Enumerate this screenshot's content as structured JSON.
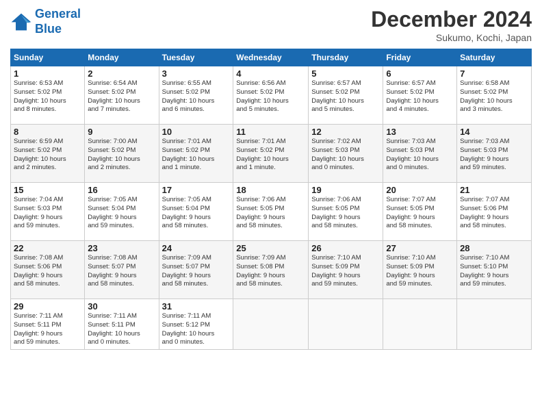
{
  "header": {
    "logo_line1": "General",
    "logo_line2": "Blue",
    "month": "December 2024",
    "location": "Sukumo, Kochi, Japan"
  },
  "weekdays": [
    "Sunday",
    "Monday",
    "Tuesday",
    "Wednesday",
    "Thursday",
    "Friday",
    "Saturday"
  ],
  "weeks": [
    [
      {
        "day": "1",
        "info": "Sunrise: 6:53 AM\nSunset: 5:02 PM\nDaylight: 10 hours\nand 8 minutes."
      },
      {
        "day": "2",
        "info": "Sunrise: 6:54 AM\nSunset: 5:02 PM\nDaylight: 10 hours\nand 7 minutes."
      },
      {
        "day": "3",
        "info": "Sunrise: 6:55 AM\nSunset: 5:02 PM\nDaylight: 10 hours\nand 6 minutes."
      },
      {
        "day": "4",
        "info": "Sunrise: 6:56 AM\nSunset: 5:02 PM\nDaylight: 10 hours\nand 5 minutes."
      },
      {
        "day": "5",
        "info": "Sunrise: 6:57 AM\nSunset: 5:02 PM\nDaylight: 10 hours\nand 5 minutes."
      },
      {
        "day": "6",
        "info": "Sunrise: 6:57 AM\nSunset: 5:02 PM\nDaylight: 10 hours\nand 4 minutes."
      },
      {
        "day": "7",
        "info": "Sunrise: 6:58 AM\nSunset: 5:02 PM\nDaylight: 10 hours\nand 3 minutes."
      }
    ],
    [
      {
        "day": "8",
        "info": "Sunrise: 6:59 AM\nSunset: 5:02 PM\nDaylight: 10 hours\nand 2 minutes."
      },
      {
        "day": "9",
        "info": "Sunrise: 7:00 AM\nSunset: 5:02 PM\nDaylight: 10 hours\nand 2 minutes."
      },
      {
        "day": "10",
        "info": "Sunrise: 7:01 AM\nSunset: 5:02 PM\nDaylight: 10 hours\nand 1 minute."
      },
      {
        "day": "11",
        "info": "Sunrise: 7:01 AM\nSunset: 5:02 PM\nDaylight: 10 hours\nand 1 minute."
      },
      {
        "day": "12",
        "info": "Sunrise: 7:02 AM\nSunset: 5:03 PM\nDaylight: 10 hours\nand 0 minutes."
      },
      {
        "day": "13",
        "info": "Sunrise: 7:03 AM\nSunset: 5:03 PM\nDaylight: 10 hours\nand 0 minutes."
      },
      {
        "day": "14",
        "info": "Sunrise: 7:03 AM\nSunset: 5:03 PM\nDaylight: 9 hours\nand 59 minutes."
      }
    ],
    [
      {
        "day": "15",
        "info": "Sunrise: 7:04 AM\nSunset: 5:03 PM\nDaylight: 9 hours\nand 59 minutes."
      },
      {
        "day": "16",
        "info": "Sunrise: 7:05 AM\nSunset: 5:04 PM\nDaylight: 9 hours\nand 59 minutes."
      },
      {
        "day": "17",
        "info": "Sunrise: 7:05 AM\nSunset: 5:04 PM\nDaylight: 9 hours\nand 58 minutes."
      },
      {
        "day": "18",
        "info": "Sunrise: 7:06 AM\nSunset: 5:05 PM\nDaylight: 9 hours\nand 58 minutes."
      },
      {
        "day": "19",
        "info": "Sunrise: 7:06 AM\nSunset: 5:05 PM\nDaylight: 9 hours\nand 58 minutes."
      },
      {
        "day": "20",
        "info": "Sunrise: 7:07 AM\nSunset: 5:05 PM\nDaylight: 9 hours\nand 58 minutes."
      },
      {
        "day": "21",
        "info": "Sunrise: 7:07 AM\nSunset: 5:06 PM\nDaylight: 9 hours\nand 58 minutes."
      }
    ],
    [
      {
        "day": "22",
        "info": "Sunrise: 7:08 AM\nSunset: 5:06 PM\nDaylight: 9 hours\nand 58 minutes."
      },
      {
        "day": "23",
        "info": "Sunrise: 7:08 AM\nSunset: 5:07 PM\nDaylight: 9 hours\nand 58 minutes."
      },
      {
        "day": "24",
        "info": "Sunrise: 7:09 AM\nSunset: 5:07 PM\nDaylight: 9 hours\nand 58 minutes."
      },
      {
        "day": "25",
        "info": "Sunrise: 7:09 AM\nSunset: 5:08 PM\nDaylight: 9 hours\nand 58 minutes."
      },
      {
        "day": "26",
        "info": "Sunrise: 7:10 AM\nSunset: 5:09 PM\nDaylight: 9 hours\nand 59 minutes."
      },
      {
        "day": "27",
        "info": "Sunrise: 7:10 AM\nSunset: 5:09 PM\nDaylight: 9 hours\nand 59 minutes."
      },
      {
        "day": "28",
        "info": "Sunrise: 7:10 AM\nSunset: 5:10 PM\nDaylight: 9 hours\nand 59 minutes."
      }
    ],
    [
      {
        "day": "29",
        "info": "Sunrise: 7:11 AM\nSunset: 5:11 PM\nDaylight: 9 hours\nand 59 minutes."
      },
      {
        "day": "30",
        "info": "Sunrise: 7:11 AM\nSunset: 5:11 PM\nDaylight: 10 hours\nand 0 minutes."
      },
      {
        "day": "31",
        "info": "Sunrise: 7:11 AM\nSunset: 5:12 PM\nDaylight: 10 hours\nand 0 minutes."
      },
      {
        "day": "",
        "info": ""
      },
      {
        "day": "",
        "info": ""
      },
      {
        "day": "",
        "info": ""
      },
      {
        "day": "",
        "info": ""
      }
    ]
  ]
}
